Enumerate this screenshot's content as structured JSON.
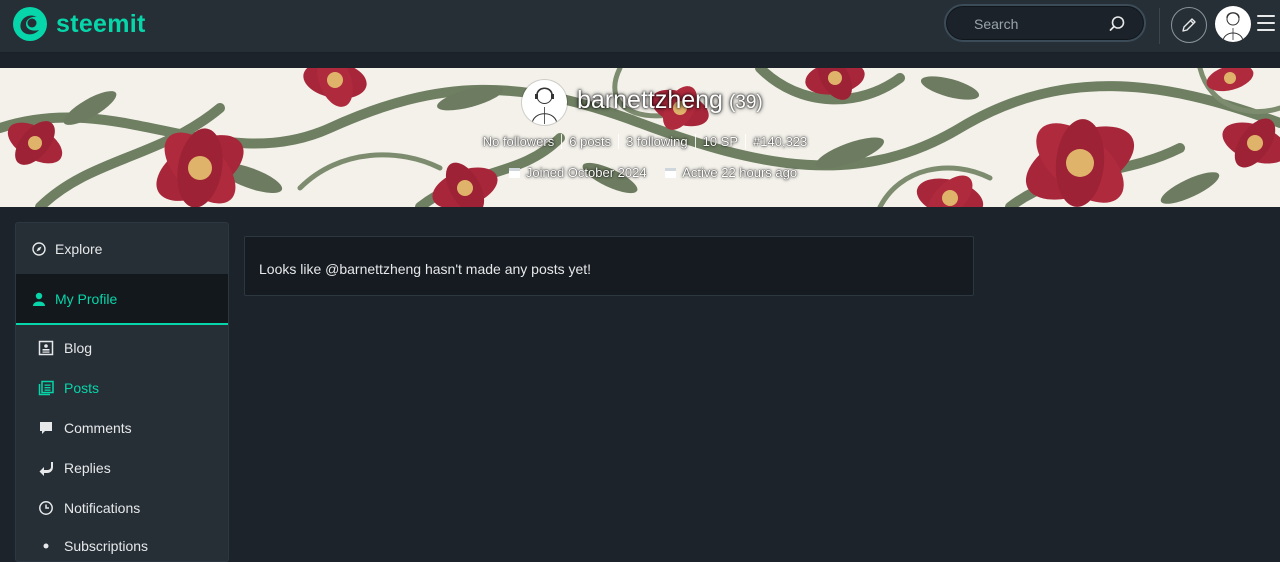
{
  "brand": {
    "name": "steemit",
    "color": "#07d6aa"
  },
  "search": {
    "placeholder": "Search"
  },
  "profile": {
    "username": "barnettzheng",
    "reputation": "(39)",
    "stats": {
      "followers": "No followers",
      "posts": "6 posts",
      "following": "3 following",
      "sp": "10 SP",
      "rank": "#140,323"
    },
    "joined": "Joined October 2024",
    "active": "Active 22 hours ago"
  },
  "sidebar": {
    "explore": "Explore",
    "my_profile": "My Profile",
    "items": [
      {
        "label": "Blog",
        "icon": "blog-icon"
      },
      {
        "label": "Posts",
        "icon": "posts-icon",
        "active": true
      },
      {
        "label": "Comments",
        "icon": "comment-icon"
      },
      {
        "label": "Replies",
        "icon": "reply-icon"
      },
      {
        "label": "Notifications",
        "icon": "clock-icon"
      },
      {
        "label": "Subscriptions",
        "icon": "subscriptions-icon"
      }
    ]
  },
  "main": {
    "empty_message": "Looks like @barnettzheng hasn't made any posts yet!"
  }
}
